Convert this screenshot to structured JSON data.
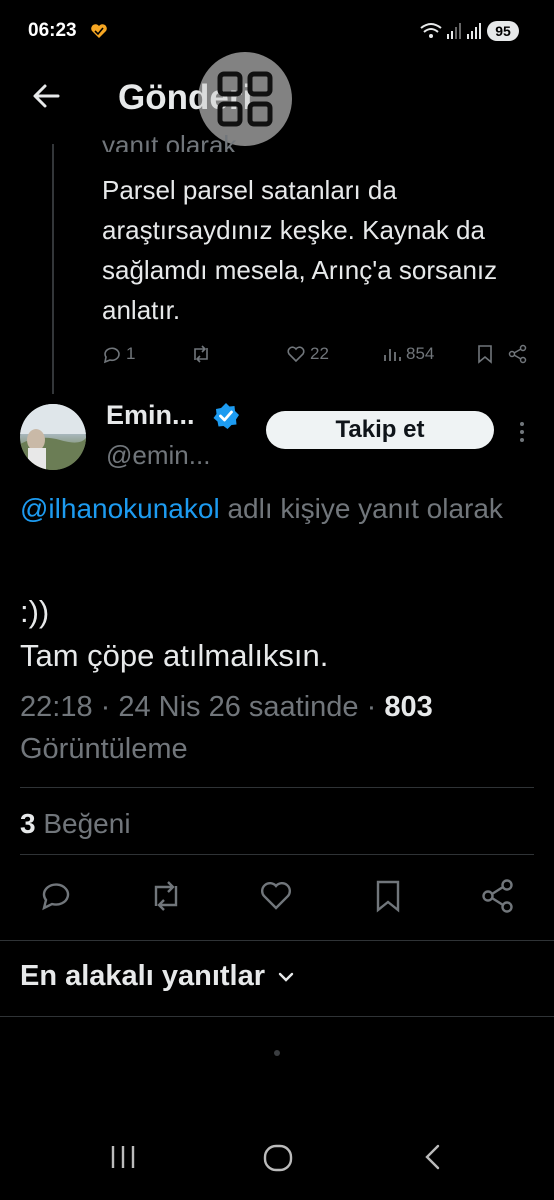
{
  "status_bar": {
    "time": "06:23",
    "battery": "95"
  },
  "header": {
    "title": "Gönderi"
  },
  "previous_reply": {
    "cut_text": "yanıt olarak",
    "body": "Parsel parsel satanları da araştırsaydınız keşke. Kaynak da sağlamdı mesela, Arınç'a sorsanız anlatır.",
    "replies": "1",
    "likes": "22",
    "views": "854"
  },
  "tweet": {
    "author_name": "Emin...",
    "author_handle": "@emin...",
    "follow_label": "Takip et",
    "reply_mention": "@ilhanokunakol",
    "reply_suffix": " adlı kişiye yanıt olarak",
    "line1": ":))",
    "line2": "Tam çöpe atılmalıksın.",
    "timestamp": "22:18 · 24 Nis 26 saatinde · ",
    "views_count": "803",
    "views_label": "Görüntüleme",
    "likes_count": "3",
    "likes_label": "Beğeni"
  },
  "sort": {
    "label": "En alakalı yanıtlar"
  },
  "colors": {
    "accent": "#1d9bf0",
    "muted": "#71767b",
    "text": "#e7e9ea",
    "background": "#000000"
  },
  "icons": [
    "back-arrow-icon",
    "verified-badge-icon",
    "more-icon",
    "reply-icon",
    "retweet-icon",
    "like-icon",
    "views-icon",
    "bookmark-icon",
    "share-icon",
    "chevron-down-icon"
  ]
}
